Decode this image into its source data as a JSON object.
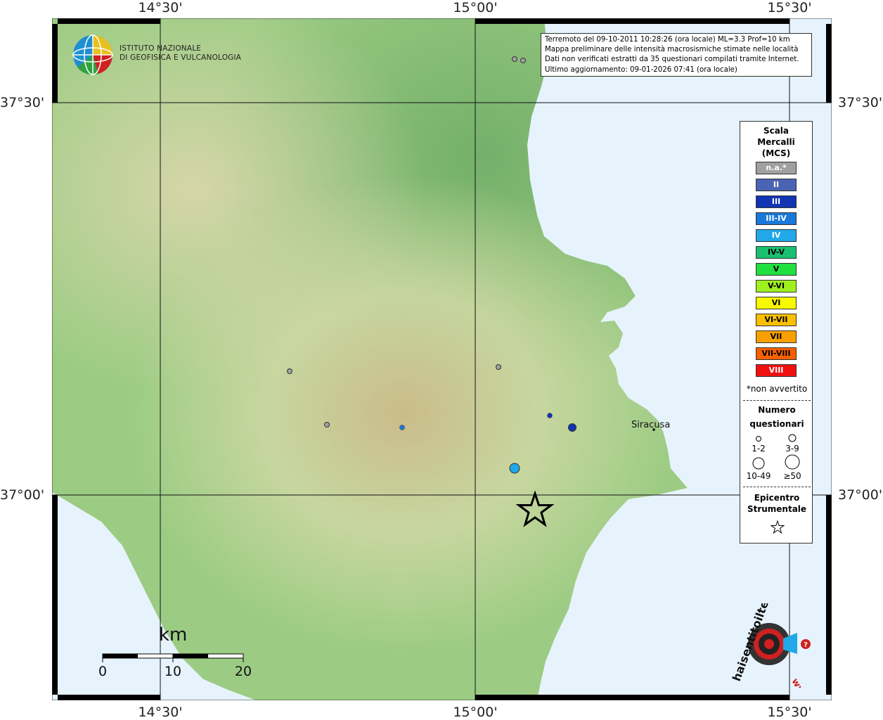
{
  "info_box": {
    "line1": "Terremoto del 09-10-2011 10:28:26 (ora locale) ML=3.3 Prof=10 km",
    "line2": "Mappa preliminare delle intensità macrosismiche stimate nelle località",
    "line3": "Dati non verificati estratti da 35 questionari compilati tramite Internet.",
    "line4": "Ultimo aggiornamento: 09-01-2026 07:41 (ora locale)"
  },
  "coords": {
    "top": [
      "14°30'",
      "15°00'",
      "15°30'"
    ],
    "bottom": [
      "14°30'",
      "15°00'",
      "15°30'"
    ],
    "left": [
      "37°30'",
      "37°00'"
    ],
    "right": [
      "37°30'",
      "37°00'"
    ]
  },
  "logo": {
    "line1": "ISTITUTO NAZIONALE",
    "line2": "DI GEOFISICA E VULCANOLOGIA"
  },
  "legend": {
    "title1": "Scala",
    "title2": "Mercalli",
    "title3": "(MCS)",
    "intensity": [
      {
        "label": "n.a.*",
        "color": "#a0a0a0",
        "text": "#ffffff"
      },
      {
        "label": "II",
        "color": "#4a64b4",
        "text": "#ffffff"
      },
      {
        "label": "III",
        "color": "#1235b4",
        "text": "#ffffff"
      },
      {
        "label": "III-IV",
        "color": "#1a78d8",
        "text": "#ffffff"
      },
      {
        "label": "IV",
        "color": "#20a8e8",
        "text": "#ffffff"
      },
      {
        "label": "IV-V",
        "color": "#18c070",
        "text": "#000000"
      },
      {
        "label": "V",
        "color": "#20e040",
        "text": "#000000"
      },
      {
        "label": "V-VI",
        "color": "#a0f020",
        "text": "#000000"
      },
      {
        "label": "VI",
        "color": "#f8f800",
        "text": "#000000"
      },
      {
        "label": "VI-VII",
        "color": "#f8c000",
        "text": "#000000"
      },
      {
        "label": "VII",
        "color": "#f8a000",
        "text": "#000000"
      },
      {
        "label": "VII-VIII",
        "color": "#f86000",
        "text": "#000000"
      },
      {
        "label": "VIII",
        "color": "#f01010",
        "text": "#ffffff"
      }
    ],
    "note": "*non avvertito",
    "count_title1": "Numero",
    "count_title2": "questionari",
    "counts": [
      "1-2",
      "3-9",
      "10-49",
      "≥50"
    ],
    "epic_title1": "Epicentro",
    "epic_title2": "Strumentale"
  },
  "city": "Siracusa",
  "scale_bar": {
    "unit": "km",
    "ticks": [
      "0",
      "10",
      "20"
    ]
  },
  "observations": [
    {
      "intensity": "n.a.*",
      "color": "#a0a0a0",
      "count_class": "1-2"
    },
    {
      "intensity": "n.a.*",
      "color": "#a0a0a0",
      "count_class": "1-2"
    },
    {
      "intensity": "n.a.*",
      "color": "#a0a0a0",
      "count_class": "1-2"
    },
    {
      "intensity": "n.a.*",
      "color": "#a0a0a0",
      "count_class": "1-2"
    },
    {
      "intensity": "n.a.*",
      "color": "#a0a0a0",
      "count_class": "1-2"
    },
    {
      "intensity": "III-IV",
      "color": "#1a78d8",
      "count_class": "1-2"
    },
    {
      "intensity": "III",
      "color": "#1235b4",
      "count_class": "1-2"
    },
    {
      "intensity": "III",
      "color": "#1235b4",
      "count_class": "3-9"
    },
    {
      "intensity": "IV",
      "color": "#20a8e8",
      "count_class": "3-9"
    }
  ],
  "colors": {
    "sea": "#e6f3fc",
    "land_low": "#7ab86a",
    "land_mid": "#c9d99a",
    "land_high": "#d8c59a"
  },
  "hsit_logo": {
    "text": "haisentitoilterremoto.it",
    "prefix": "www."
  }
}
